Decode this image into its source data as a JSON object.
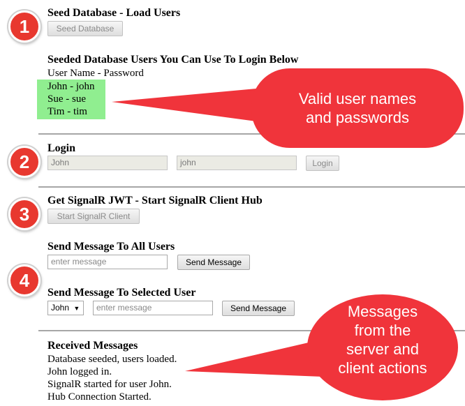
{
  "steps": [
    "1",
    "2",
    "3",
    "4"
  ],
  "seed": {
    "heading": "Seed Database - Load Users",
    "button_label": "Seed Database"
  },
  "seeded_users": {
    "heading": "Seeded Database Users You Can Use To Login Below",
    "column_header": "User Name - Password",
    "users": [
      "John - john",
      "Sue - sue",
      "Tim - tim"
    ],
    "highlight_color": "#90ee90"
  },
  "login": {
    "heading": "Login",
    "username_value": "John",
    "password_value": "john",
    "button_label": "Login"
  },
  "signalr": {
    "heading": "Get SignalR JWT - Start SignalR Client Hub",
    "button_label": "Start SignalR Client"
  },
  "send_all": {
    "heading": "Send Message To All Users",
    "input_placeholder": "enter message",
    "button_label": "Send Message"
  },
  "send_selected": {
    "heading": "Send Message To Selected User",
    "selected_user": "John",
    "input_placeholder": "enter message",
    "button_label": "Send Message"
  },
  "received": {
    "heading": "Received Messages",
    "messages": [
      "Database seeded, users loaded.",
      "John logged in.",
      "SignalR started for user John.",
      "Hub Connection Started."
    ]
  },
  "callouts": {
    "users": [
      "Valid user names",
      "and passwords"
    ],
    "messages": [
      "Messages",
      "from the",
      "server and",
      "client actions"
    ],
    "color": "#f0343b"
  }
}
